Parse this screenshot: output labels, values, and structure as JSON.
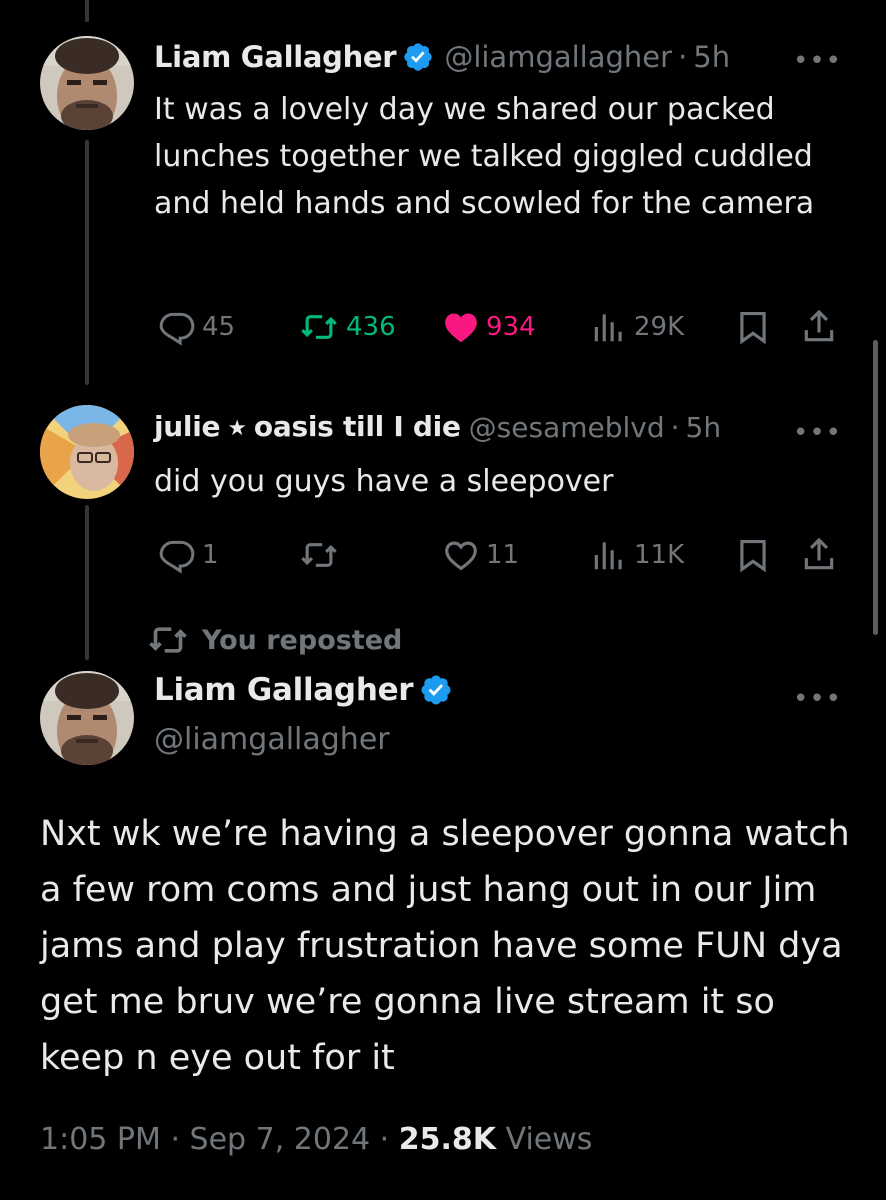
{
  "tweet1": {
    "name": "Liam Gallagher",
    "handle": "@liamgallagher",
    "separator": "·",
    "time": "5h",
    "text": "It was a lovely day we shared our packed lunches together we talked giggled cuddled and held hands and scowled for the camera",
    "replies": "45",
    "reposts": "436",
    "likes": "934",
    "views": "29K",
    "more": "•••"
  },
  "tweet2": {
    "name": "julie ⭑ oasis till I die",
    "handle": "@sesameblvd",
    "separator": "·",
    "time": "5h",
    "text": "did you guys have a sleepover",
    "replies": "1",
    "reposts": "",
    "likes": "11",
    "views": "11K",
    "more": "•••"
  },
  "repost_notice": "You reposted",
  "main_tweet": {
    "name": "Liam Gallagher",
    "handle": "@liamgallagher",
    "more": "•••",
    "text": "Nxt wk we’re having a sleepover gonna watch a few rom coms and just hang out in our Jim jams and play frustration have some FUN dya get me bruv we’re gonna live stream it so keep n eye out for it",
    "time": "1:05 PM",
    "date": "Sep 7, 2024",
    "separator": "·",
    "views_count": "25.8K",
    "views_label": "Views"
  },
  "icons": {
    "reply": "reply-icon",
    "repost": "repost-icon",
    "like": "heart-icon",
    "views": "views-icon",
    "bookmark": "bookmark-icon",
    "share": "share-icon",
    "verified": "verified-badge-icon"
  },
  "colors": {
    "background": "#000000",
    "text": "#e7e9ea",
    "muted": "#71767b",
    "repost_green": "#00ba7c",
    "like_pink": "#f91880",
    "verified_blue": "#1d9bf0"
  }
}
